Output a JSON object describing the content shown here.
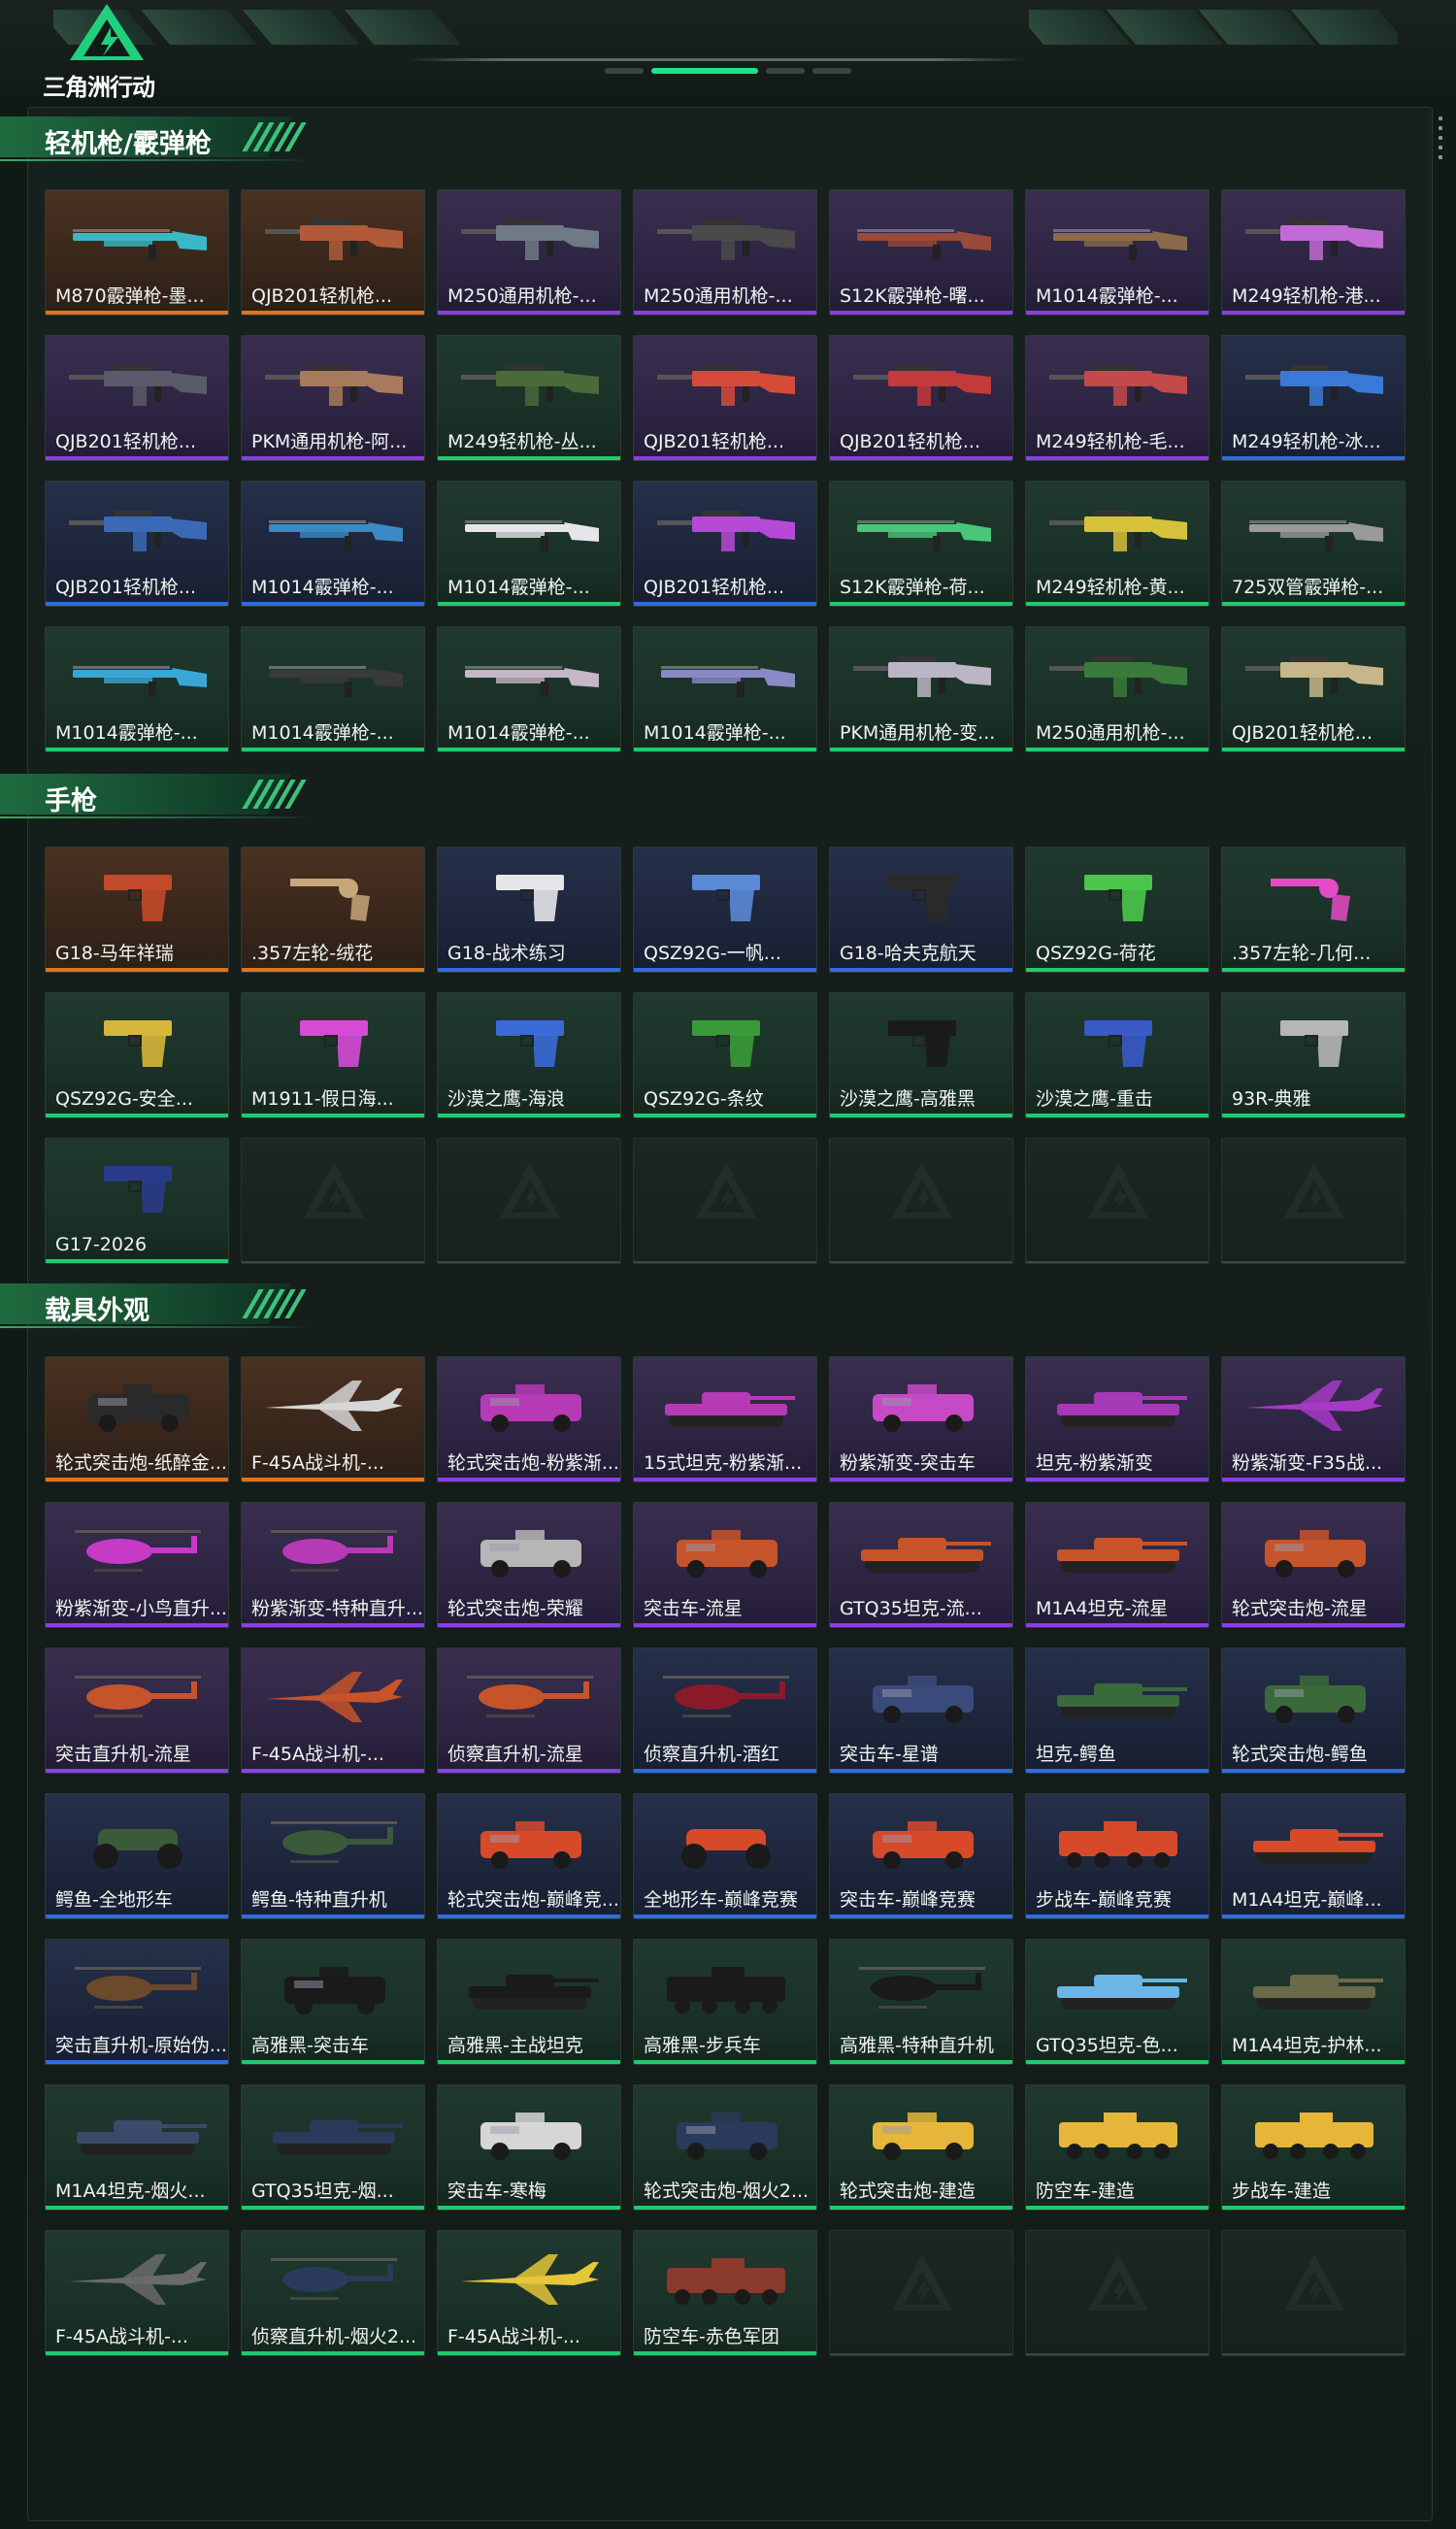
{
  "app": {
    "logo_text": "三角洲行动"
  },
  "sections": [
    {
      "title": "轻机枪/霰弹枪",
      "items": [
        {
          "label": "M870霰弹枪-墨...",
          "tier": "orange",
          "icon": "shotgun-icon",
          "color": "#3bb8c6"
        },
        {
          "label": "QJB201轻机枪...",
          "tier": "orange",
          "icon": "machine-gun-icon",
          "color": "#b05a3a"
        },
        {
          "label": "M250通用机枪-...",
          "tier": "purple",
          "icon": "machine-gun-icon",
          "color": "#6e7a86"
        },
        {
          "label": "M250通用机枪-...",
          "tier": "purple",
          "icon": "machine-gun-icon",
          "color": "#4a4a4a"
        },
        {
          "label": "S12K霰弹枪-曙...",
          "tier": "purple",
          "icon": "shotgun-icon",
          "color": "#9a4a3a"
        },
        {
          "label": "M1014霰弹枪-...",
          "tier": "purple",
          "icon": "shotgun-icon",
          "color": "#8a6a4a"
        },
        {
          "label": "M249轻机枪-港...",
          "tier": "purple",
          "icon": "machine-gun-icon",
          "color": "#c26bd6"
        },
        {
          "label": "QJB201轻机枪...",
          "tier": "purple",
          "icon": "machine-gun-icon",
          "color": "#5a5a6a"
        },
        {
          "label": "PKM通用机枪-阿...",
          "tier": "purple",
          "icon": "machine-gun-icon",
          "color": "#a67a5a"
        },
        {
          "label": "M249轻机枪-丛...",
          "tier": "green",
          "icon": "machine-gun-icon",
          "color": "#4a6a3a"
        },
        {
          "label": "QJB201轻机枪...",
          "tier": "purple",
          "icon": "machine-gun-icon",
          "color": "#d64a3a"
        },
        {
          "label": "QJB201轻机枪...",
          "tier": "purple",
          "icon": "machine-gun-icon",
          "color": "#c23a3a"
        },
        {
          "label": "M249轻机枪-毛...",
          "tier": "purple",
          "icon": "machine-gun-icon",
          "color": "#c24a4a"
        },
        {
          "label": "M249轻机枪-冰...",
          "tier": "blue",
          "icon": "machine-gun-icon",
          "color": "#3a7ad6"
        },
        {
          "label": "QJB201轻机枪...",
          "tier": "blue",
          "icon": "machine-gun-icon",
          "color": "#3a6ab6"
        },
        {
          "label": "M1014霰弹枪-...",
          "tier": "blue",
          "icon": "shotgun-icon",
          "color": "#3a8ac6"
        },
        {
          "label": "M1014霰弹枪-...",
          "tier": "green",
          "icon": "shotgun-icon",
          "color": "#e6e6ea"
        },
        {
          "label": "QJB201轻机枪...",
          "tier": "blue",
          "icon": "machine-gun-icon",
          "color": "#b64ad6"
        },
        {
          "label": "S12K霰弹枪-荷...",
          "tier": "green",
          "icon": "shotgun-icon",
          "color": "#4ac67a"
        },
        {
          "label": "M249轻机枪-黄...",
          "tier": "green",
          "icon": "machine-gun-icon",
          "color": "#d6c23a"
        },
        {
          "label": "725双管霰弹枪-...",
          "tier": "green",
          "icon": "shotgun-icon",
          "color": "#9a9a9a"
        },
        {
          "label": "M1014霰弹枪-...",
          "tier": "green",
          "icon": "shotgun-icon",
          "color": "#3aa6d6"
        },
        {
          "label": "M1014霰弹枪-...",
          "tier": "green",
          "icon": "shotgun-icon",
          "color": "#3a3a3a"
        },
        {
          "label": "M1014霰弹枪-...",
          "tier": "green",
          "icon": "shotgun-icon",
          "color": "#c6b6c6"
        },
        {
          "label": "M1014霰弹枪-...",
          "tier": "green",
          "icon": "shotgun-icon",
          "color": "#8a8ac6"
        },
        {
          "label": "PKM通用机枪-变...",
          "tier": "green",
          "icon": "machine-gun-icon",
          "color": "#bab6c6"
        },
        {
          "label": "M250通用机枪-...",
          "tier": "green",
          "icon": "machine-gun-icon",
          "color": "#3a7a3a"
        },
        {
          "label": "QJB201轻机枪...",
          "tier": "green",
          "icon": "machine-gun-icon",
          "color": "#c6b68a"
        }
      ]
    },
    {
      "title": "手枪",
      "items": [
        {
          "label": "G18-马年祥瑞",
          "tier": "orange",
          "icon": "pistol-icon",
          "color": "#c24a2a"
        },
        {
          "label": ".357左轮-绒花",
          "tier": "orange",
          "icon": "revolver-icon",
          "color": "#c6a67a"
        },
        {
          "label": "G18-战术练习",
          "tier": "blue",
          "icon": "pistol-icon",
          "color": "#e6e6ea"
        },
        {
          "label": "QSZ92G-一帆...",
          "tier": "blue",
          "icon": "pistol-icon",
          "color": "#5a8ad6"
        },
        {
          "label": "G18-哈夫克航天",
          "tier": "blue",
          "icon": "pistol-icon",
          "color": "#2a2a2a"
        },
        {
          "label": "QSZ92G-荷花",
          "tier": "green",
          "icon": "pistol-icon",
          "color": "#4ac64a"
        },
        {
          "label": ".357左轮-几何...",
          "tier": "green",
          "icon": "revolver-icon",
          "color": "#e64ac6"
        },
        {
          "label": "QSZ92G-安全...",
          "tier": "green",
          "icon": "pistol-icon",
          "color": "#d6b63a"
        },
        {
          "label": "M1911-假日海...",
          "tier": "green",
          "icon": "pistol-icon",
          "color": "#d64ad6"
        },
        {
          "label": "沙漠之鹰-海浪",
          "tier": "green",
          "icon": "pistol-icon",
          "color": "#3a6ad6"
        },
        {
          "label": "QSZ92G-条纹",
          "tier": "green",
          "icon": "pistol-icon",
          "color": "#3a9a3a"
        },
        {
          "label": "沙漠之鹰-高雅黑",
          "tier": "green",
          "icon": "pistol-icon",
          "color": "#1a1a1a"
        },
        {
          "label": "沙漠之鹰-重击",
          "tier": "green",
          "icon": "pistol-icon",
          "color": "#3a5ac6"
        },
        {
          "label": "93R-典雅",
          "tier": "green",
          "icon": "pistol-icon",
          "color": "#b6b6b6"
        },
        {
          "label": "G17-2026",
          "tier": "green",
          "icon": "pistol-icon",
          "color": "#2a3a8a"
        },
        {
          "label": "",
          "tier": "empty"
        },
        {
          "label": "",
          "tier": "empty"
        },
        {
          "label": "",
          "tier": "empty"
        },
        {
          "label": "",
          "tier": "empty"
        },
        {
          "label": "",
          "tier": "empty"
        },
        {
          "label": "",
          "tier": "empty"
        }
      ]
    },
    {
      "title": "载具外观",
      "items": [
        {
          "label": "轮式突击炮-纸醉金...",
          "tier": "orange",
          "icon": "armored-car-icon",
          "color": "#2a2a2a"
        },
        {
          "label": "F-45A战斗机-...",
          "tier": "orange",
          "icon": "jet-icon",
          "color": "#d6d6d6"
        },
        {
          "label": "轮式突击炮-粉紫渐...",
          "tier": "purple",
          "icon": "armored-car-icon",
          "color": "#b63ab6"
        },
        {
          "label": "15式坦克-粉紫渐...",
          "tier": "purple",
          "icon": "tank-icon",
          "color": "#b63ab6"
        },
        {
          "label": "粉紫渐变-突击车",
          "tier": "purple",
          "icon": "armored-car-icon",
          "color": "#c64ac6"
        },
        {
          "label": "坦克-粉紫渐变",
          "tier": "purple",
          "icon": "tank-icon",
          "color": "#a63ab6"
        },
        {
          "label": "粉紫渐变-F35战...",
          "tier": "purple",
          "icon": "jet-icon",
          "color": "#a63ac6"
        },
        {
          "label": "粉紫渐变-小鸟直升...",
          "tier": "purple",
          "icon": "helicopter-icon",
          "color": "#c63ac6"
        },
        {
          "label": "粉紫渐变-特种直升...",
          "tier": "purple",
          "icon": "helicopter-icon",
          "color": "#b63ab6"
        },
        {
          "label": "轮式突击炮-荣耀",
          "tier": "purple",
          "icon": "armored-car-icon",
          "color": "#b6b6b6"
        },
        {
          "label": "突击车-流星",
          "tier": "purple",
          "icon": "armored-car-icon",
          "color": "#c6542a"
        },
        {
          "label": "GTQ35坦克-流...",
          "tier": "purple",
          "icon": "tank-icon",
          "color": "#c6542a"
        },
        {
          "label": "M1A4坦克-流星",
          "tier": "purple",
          "icon": "tank-icon",
          "color": "#c6542a"
        },
        {
          "label": "轮式突击炮-流星",
          "tier": "purple",
          "icon": "armored-car-icon",
          "color": "#c6542a"
        },
        {
          "label": "突击直升机-流星",
          "tier": "purple",
          "icon": "helicopter-icon",
          "color": "#c6542a"
        },
        {
          "label": "F-45A战斗机-...",
          "tier": "purple",
          "icon": "jet-icon",
          "color": "#c6542a"
        },
        {
          "label": "侦察直升机-流星",
          "tier": "purple",
          "icon": "helicopter-icon",
          "color": "#c6542a"
        },
        {
          "label": "侦察直升机-酒红",
          "tier": "blue",
          "icon": "helicopter-icon",
          "color": "#8a1a2a"
        },
        {
          "label": "突击车-星谱",
          "tier": "blue",
          "icon": "armored-car-icon",
          "color": "#3a4a7a"
        },
        {
          "label": "坦克-鳄鱼",
          "tier": "blue",
          "icon": "tank-icon",
          "color": "#3a6a3a"
        },
        {
          "label": "轮式突击炮-鳄鱼",
          "tier": "blue",
          "icon": "armored-car-icon",
          "color": "#3a6a3a"
        },
        {
          "label": "鳄鱼-全地形车",
          "tier": "blue",
          "icon": "atv-icon",
          "color": "#3a5a3a"
        },
        {
          "label": "鳄鱼-特种直升机",
          "tier": "blue",
          "icon": "helicopter-icon",
          "color": "#3a5a3a"
        },
        {
          "label": "轮式突击炮-巅峰竞...",
          "tier": "blue",
          "icon": "armored-car-icon",
          "color": "#d64a2a"
        },
        {
          "label": "全地形车-巅峰竞赛",
          "tier": "blue",
          "icon": "atv-icon",
          "color": "#d64a2a"
        },
        {
          "label": "突击车-巅峰竞赛",
          "tier": "blue",
          "icon": "armored-car-icon",
          "color": "#d64a2a"
        },
        {
          "label": "步战车-巅峰竞赛",
          "tier": "blue",
          "icon": "ifv-icon",
          "color": "#d64a2a"
        },
        {
          "label": "M1A4坦克-巅峰...",
          "tier": "blue",
          "icon": "tank-icon",
          "color": "#d64a2a"
        },
        {
          "label": "突击直升机-原始伪...",
          "tier": "blue",
          "icon": "helicopter-icon",
          "color": "#6a4a2a"
        },
        {
          "label": "高雅黑-突击车",
          "tier": "green",
          "icon": "armored-car-icon",
          "color": "#1a1a1a"
        },
        {
          "label": "高雅黑-主战坦克",
          "tier": "green",
          "icon": "tank-icon",
          "color": "#1a1a1a"
        },
        {
          "label": "高雅黑-步兵车",
          "tier": "green",
          "icon": "ifv-icon",
          "color": "#1a1a1a"
        },
        {
          "label": "高雅黑-特种直升机",
          "tier": "green",
          "icon": "helicopter-icon",
          "color": "#1a1a1a"
        },
        {
          "label": "GTQ35坦克-色...",
          "tier": "green",
          "icon": "tank-icon",
          "color": "#6ab6e6"
        },
        {
          "label": "M1A4坦克-护林...",
          "tier": "green",
          "icon": "tank-icon",
          "color": "#6a6a4a"
        },
        {
          "label": "M1A4坦克-烟火...",
          "tier": "green",
          "icon": "tank-icon",
          "color": "#3a4a6a"
        },
        {
          "label": "GTQ35坦克-烟...",
          "tier": "green",
          "icon": "tank-icon",
          "color": "#2a3a5a"
        },
        {
          "label": "突击车-寒梅",
          "tier": "green",
          "icon": "armored-car-icon",
          "color": "#d6d6d6"
        },
        {
          "label": "轮式突击炮-烟火2...",
          "tier": "green",
          "icon": "armored-car-icon",
          "color": "#2a3a5a"
        },
        {
          "label": "轮式突击炮-建造",
          "tier": "green",
          "icon": "armored-car-icon",
          "color": "#e6b63a"
        },
        {
          "label": "防空车-建造",
          "tier": "green",
          "icon": "ifv-icon",
          "color": "#e6b63a"
        },
        {
          "label": "步战车-建造",
          "tier": "green",
          "icon": "ifv-icon",
          "color": "#e6b63a"
        },
        {
          "label": "F-45A战斗机-...",
          "tier": "green",
          "icon": "jet-icon",
          "color": "#6a6a6a"
        },
        {
          "label": "侦察直升机-烟火2...",
          "tier": "green",
          "icon": "helicopter-icon",
          "color": "#2a3a5a"
        },
        {
          "label": "F-45A战斗机-...",
          "tier": "green",
          "icon": "jet-icon",
          "color": "#e6c63a"
        },
        {
          "label": "防空车-赤色军团",
          "tier": "green",
          "icon": "ifv-icon",
          "color": "#8a3a2a"
        },
        {
          "label": "",
          "tier": "empty"
        },
        {
          "label": "",
          "tier": "empty"
        },
        {
          "label": "",
          "tier": "empty"
        }
      ]
    }
  ]
}
